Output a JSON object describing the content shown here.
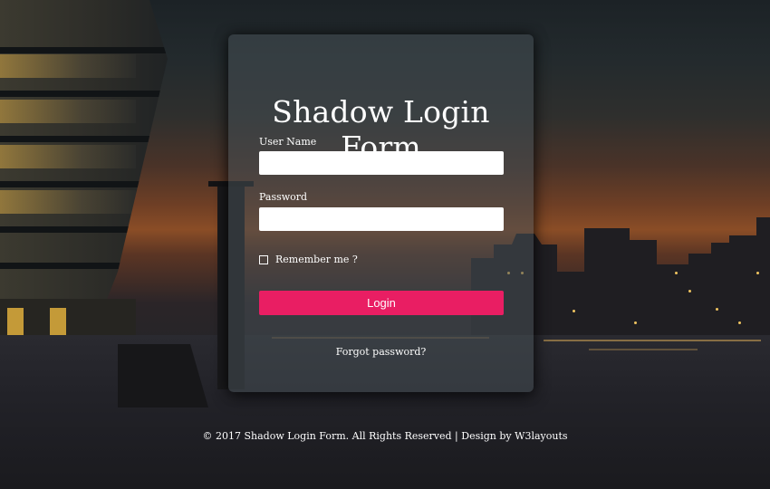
{
  "form": {
    "title": "Shadow Login Form",
    "username_label": "User Name",
    "username_value": "",
    "password_label": "Password",
    "password_value": "",
    "remember_label": "Remember me ?",
    "login_label": "Login",
    "forgot_label": "Forgot password?"
  },
  "footer": {
    "text": "© 2017 Shadow Login Form. All Rights Reserved | Design by ",
    "link_label": "W3layouts"
  },
  "colors": {
    "accent": "#e91e63",
    "text": "#ffffff"
  }
}
